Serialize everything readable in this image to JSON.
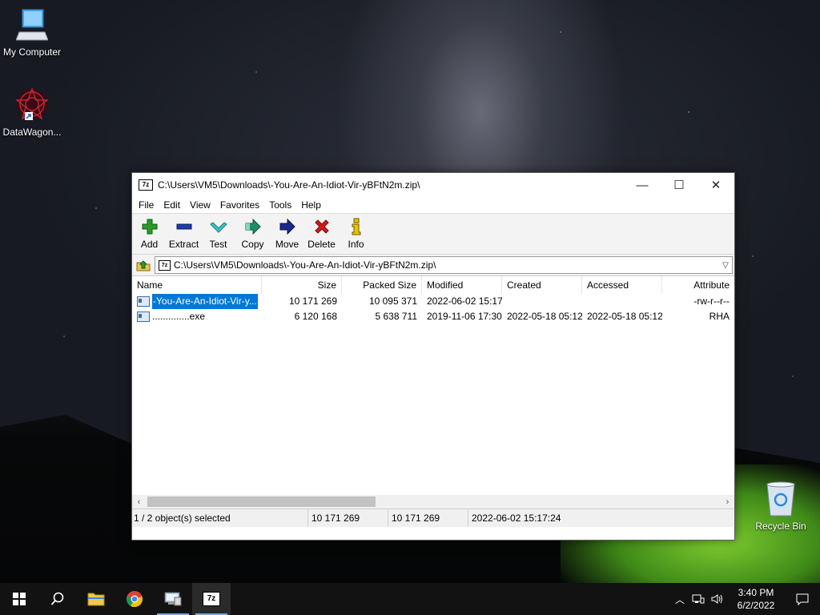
{
  "desktop": {
    "icons": [
      {
        "label": "My Computer"
      },
      {
        "label": "DataWagon..."
      },
      {
        "label": "Recycle Bin"
      }
    ]
  },
  "window": {
    "title": "C:\\Users\\VM5\\Downloads\\-You-Are-An-Idiot-Vir-yBFtN2m.zip\\",
    "app_icon_text": "7z",
    "controls": {
      "minimize": "—",
      "maximize": "☐",
      "close": "✕"
    }
  },
  "menu": [
    "File",
    "Edit",
    "View",
    "Favorites",
    "Tools",
    "Help"
  ],
  "toolbar": [
    {
      "label": "Add",
      "icon": "plus-icon",
      "color": "#2a9a2a"
    },
    {
      "label": "Extract",
      "icon": "minus-icon",
      "color": "#1a3fa8"
    },
    {
      "label": "Test",
      "icon": "check-icon",
      "color": "#2aa6a6"
    },
    {
      "label": "Copy",
      "icon": "double-arrow-icon",
      "color": "#1f8f6a"
    },
    {
      "label": "Move",
      "icon": "arrow-right-icon",
      "color": "#1a2a8a"
    },
    {
      "label": "Delete",
      "icon": "x-icon",
      "color": "#d21b1b"
    },
    {
      "label": "Info",
      "icon": "info-icon",
      "color": "#c9a400"
    }
  ],
  "address": {
    "path": "C:\\Users\\VM5\\Downloads\\-You-Are-An-Idiot-Vir-yBFtN2m.zip\\"
  },
  "columns": [
    "Name",
    "Size",
    "Packed Size",
    "Modified",
    "Created",
    "Accessed",
    "Attribute"
  ],
  "files": [
    {
      "name": "-You-Are-An-Idiot-Vir-y...",
      "size": "10 171 269",
      "packed": "10 095 371",
      "modified": "2022-06-02 15:17",
      "created": "",
      "accessed": "",
      "attr": "-rw-r--r--",
      "selected": true
    },
    {
      "name": "..............exe",
      "size": "6 120 168",
      "packed": "5 638 711",
      "modified": "2019-11-06 17:30",
      "created": "2022-05-18 05:12",
      "accessed": "2022-05-18 05:12",
      "attr": "RHA",
      "selected": false
    }
  ],
  "status": {
    "selection": "1 / 2 object(s) selected",
    "size": "10 171 269",
    "packed": "10 171 269",
    "modified": "2022-06-02 15:17:24"
  },
  "taskbar": {
    "time": "3:40 PM",
    "date": "6/2/2022",
    "accent": "#7aa7d8"
  }
}
